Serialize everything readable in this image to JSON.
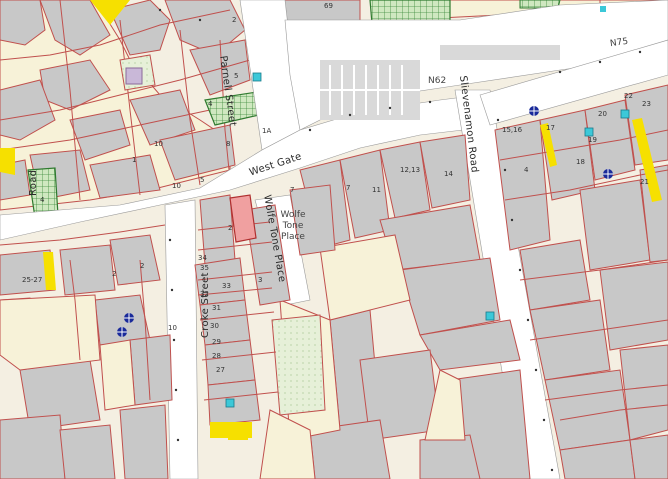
{
  "map": {
    "colors": {
      "background": "#f4efe2",
      "building": "#c8c8c8",
      "parcel_line": "#c0504d",
      "road": "#ffffff",
      "highlight_property": "#f0a0a0",
      "yellow_marker": "#f6e000",
      "green_space": "#cfe8c0",
      "cyan_marker": "#3cc8d8",
      "parking": "#d2d2d2"
    },
    "streets": {
      "parnell": "Parnell Street",
      "west_gate": "West Gate",
      "wolfe_tone_place_1": "Wolfe Tone Place",
      "wolfe_tone_place_2": "Wolfe Tone Place",
      "croke": "Croke Street",
      "slievenamon": "Slievenamon Road",
      "n75": "N75",
      "n62": "N62",
      "road_left": "Road"
    },
    "numbers": {
      "n69": "69",
      "n2a": "2",
      "n5": "5",
      "n4": "4",
      "n1a": "1A",
      "n8": "8",
      "n10a": "10",
      "n1": "1",
      "n10b": "10",
      "n5b": "5",
      "n7a": "7",
      "n7b": "7",
      "n11": "11",
      "n1213": "12,13",
      "n14": "14",
      "n2b": "2",
      "n2c": "2",
      "n2527": "25-27",
      "n2d": "2",
      "n34": "34",
      "n35": "35",
      "n33": "33",
      "n32": "32",
      "n31": "31",
      "n30": "30",
      "n29": "29",
      "n28": "28",
      "n27": "27",
      "n10c": "10",
      "n3": "3",
      "n1516": "15,16",
      "n17": "17",
      "n4b": "4",
      "n18": "18",
      "n19": "19",
      "n20": "20",
      "n22": "22",
      "n23": "23",
      "n21": "21",
      "n4c": "4"
    }
  }
}
